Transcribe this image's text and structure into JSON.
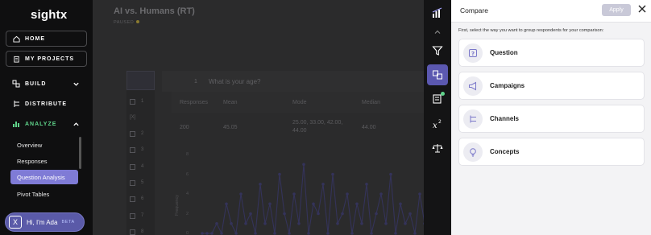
{
  "app": {
    "logo": "sightx"
  },
  "sidebar": {
    "home": "HOME",
    "projects": "MY PROJECTS",
    "build": "BUILD",
    "distribute": "DISTRIBUTE",
    "analyze": "ANALYZE",
    "sub_items": [
      "Overview",
      "Responses",
      "Question Analysis",
      "Pivot Tables"
    ],
    "active_sub": "Question Analysis"
  },
  "ada": {
    "label": "Hi, I'm Ada",
    "beta": "BETA"
  },
  "survey": {
    "title": "AI vs. Humans (RT)",
    "status": "PAUSED",
    "question_number": "1",
    "question_text": "What is your age?",
    "question_list": [
      "1",
      "[X]",
      "2",
      "3",
      "4",
      "5",
      "6",
      "7",
      "8"
    ]
  },
  "stats": {
    "headers": [
      "Responses",
      "Mean",
      "Mode",
      "Median"
    ],
    "values": [
      "200",
      "45.05",
      "25.00, 33.00, 42.00, 44.00",
      "44.00"
    ]
  },
  "chart_data": {
    "type": "line",
    "ylabel": "Frequency",
    "yticks": [
      "8",
      "6",
      "4",
      "2",
      "0"
    ],
    "ylim": [
      0,
      8
    ],
    "values": [
      0,
      0,
      0,
      1,
      0,
      3,
      1,
      0,
      4,
      1,
      2,
      0,
      5,
      1,
      3,
      0,
      6,
      2,
      0,
      4,
      1,
      7,
      0,
      3,
      2,
      5,
      0,
      6,
      1,
      2,
      4,
      0,
      3,
      1,
      5,
      0,
      2,
      4,
      1,
      6,
      0,
      3,
      1,
      2,
      0,
      4,
      1
    ]
  },
  "compare_panel": {
    "title": "Compare",
    "apply": "Apply",
    "hint": "First, select the way you want to group respondents for your comparison:",
    "options": [
      {
        "label": "Question",
        "icon": "question-icon"
      },
      {
        "label": "Campaigns",
        "icon": "megaphone-icon"
      },
      {
        "label": "Channels",
        "icon": "channels-icon"
      },
      {
        "label": "Concepts",
        "icon": "lightbulb-icon"
      }
    ]
  }
}
